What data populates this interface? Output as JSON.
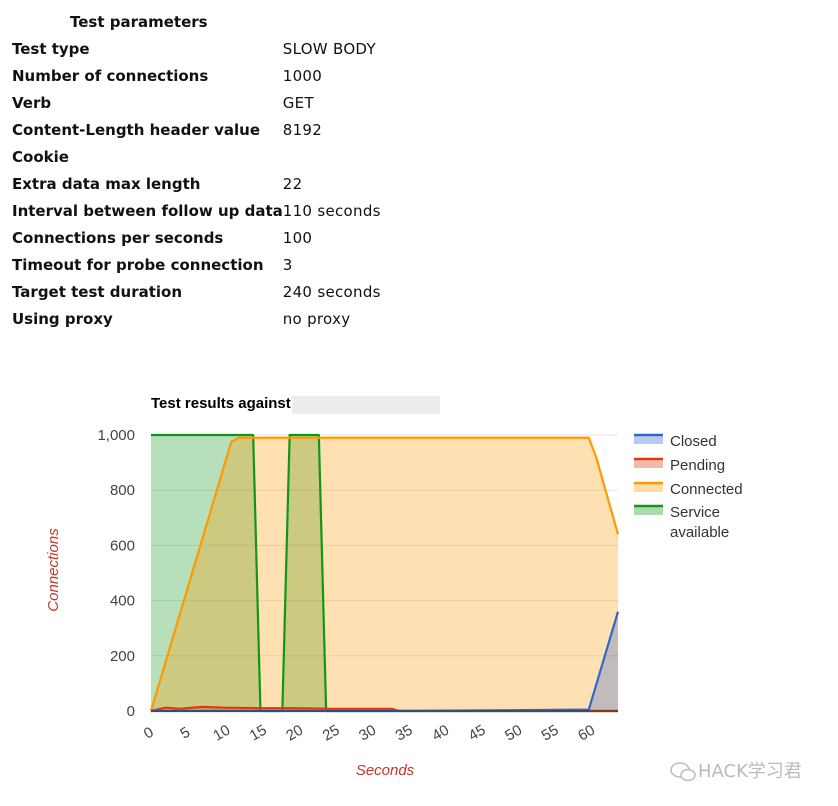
{
  "params": {
    "title": "Test parameters",
    "rows": [
      {
        "key": "Test type",
        "value": "SLOW BODY"
      },
      {
        "key": "Number of connections",
        "value": "1000"
      },
      {
        "key": "Verb",
        "value": "GET"
      },
      {
        "key": "Content-Length header value",
        "value": "8192"
      },
      {
        "key": "Cookie",
        "value": ""
      },
      {
        "key": "Extra data max length",
        "value": "22"
      },
      {
        "key": "Interval between follow up data",
        "value": "110 seconds"
      },
      {
        "key": "Connections per seconds",
        "value": "100"
      },
      {
        "key": "Timeout for probe connection",
        "value": "3"
      },
      {
        "key": "Target test duration",
        "value": "240 seconds"
      },
      {
        "key": "Using proxy",
        "value": "no proxy"
      }
    ]
  },
  "chart_data": {
    "type": "area",
    "title": "Test results against",
    "xlabel": "Seconds",
    "ylabel": "Connections",
    "xlim": [
      0,
      64
    ],
    "ylim": [
      0,
      1000
    ],
    "xticks": [
      0,
      5,
      10,
      15,
      20,
      25,
      30,
      35,
      40,
      45,
      50,
      55,
      60
    ],
    "yticks": [
      0,
      200,
      400,
      600,
      800,
      1000
    ],
    "ytick_labels": [
      "0",
      "200",
      "400",
      "600",
      "800",
      "1,000"
    ],
    "grid": true,
    "legend_position": "right",
    "series": [
      {
        "name": "Closed",
        "color": "#3366cc",
        "x": [
          0,
          33,
          60,
          64
        ],
        "y": [
          0,
          0,
          5,
          360
        ]
      },
      {
        "name": "Pending",
        "color": "#dc3912",
        "x": [
          0,
          2,
          4,
          7,
          10,
          15,
          20,
          25,
          33,
          34,
          64
        ],
        "y": [
          0,
          12,
          8,
          15,
          12,
          10,
          10,
          8,
          8,
          0,
          0
        ]
      },
      {
        "name": "Connected",
        "color": "#ff9900",
        "x": [
          0,
          11,
          12,
          14,
          60,
          61,
          64
        ],
        "y": [
          0,
          975,
          990,
          990,
          990,
          920,
          640
        ]
      },
      {
        "name": "Service available",
        "color": "#109618",
        "x": [
          0,
          14,
          15,
          18,
          19,
          23,
          24,
          64
        ],
        "y": [
          1000,
          1000,
          0,
          0,
          1000,
          1000,
          0,
          0
        ]
      }
    ],
    "legend_labels": [
      "Closed",
      "Pending",
      "Connected",
      "Service",
      "available"
    ]
  },
  "watermark": "HACK学习君"
}
